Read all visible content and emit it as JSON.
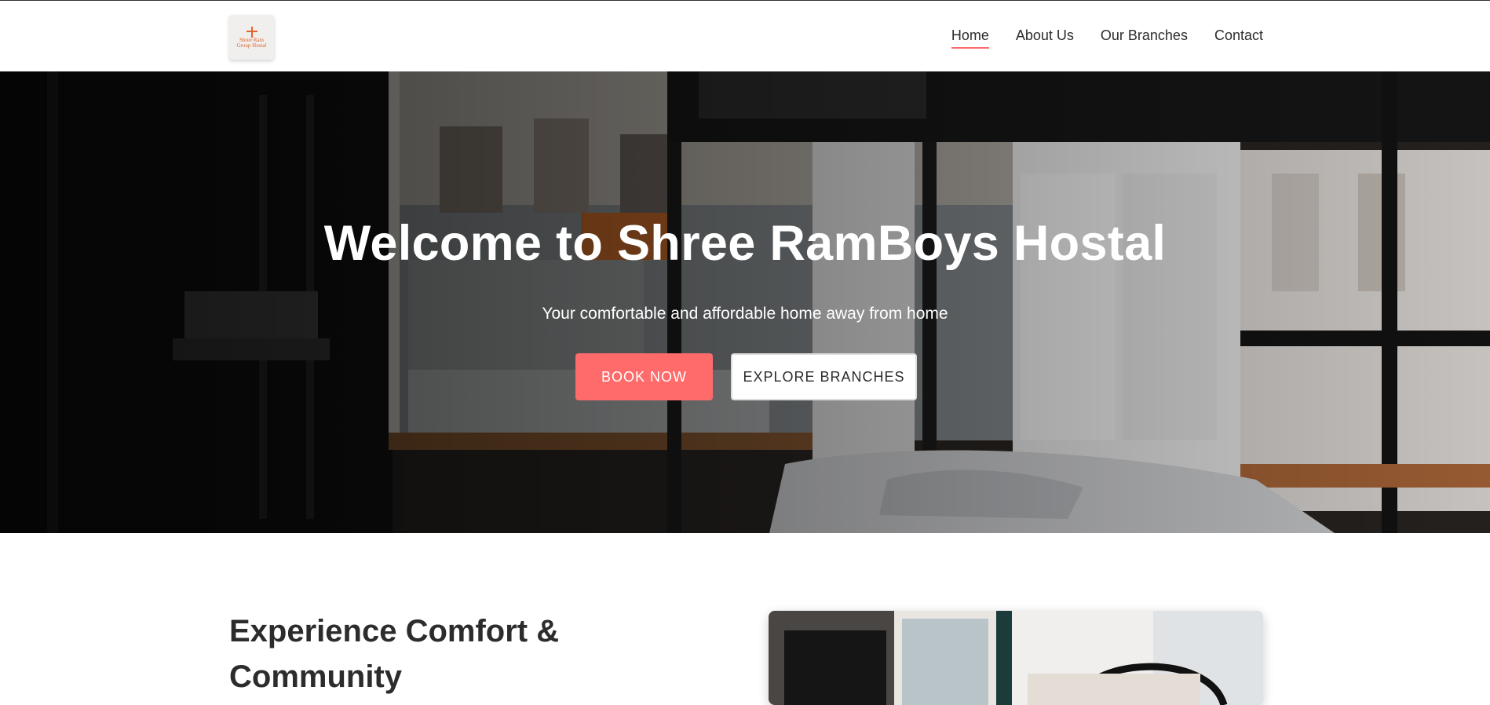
{
  "header": {
    "logo_text": "Shree Ram Group Hostal",
    "nav": [
      {
        "label": "Home",
        "active": true
      },
      {
        "label": "About Us",
        "active": false
      },
      {
        "label": "Our Branches",
        "active": false
      },
      {
        "label": "Contact",
        "active": false
      }
    ]
  },
  "hero": {
    "title": "Welcome to Shree RamBoys Hostal",
    "subtitle": "Your comfortable and affordable home away from home",
    "primary_button": "BOOK NOW",
    "secondary_button": "EXPLORE BRANCHES"
  },
  "intro": {
    "title": "Experience Comfort & Community"
  },
  "colors": {
    "accent": "#ff6b6b",
    "text": "#2c2c2c",
    "logo_orange": "#e0632a"
  }
}
